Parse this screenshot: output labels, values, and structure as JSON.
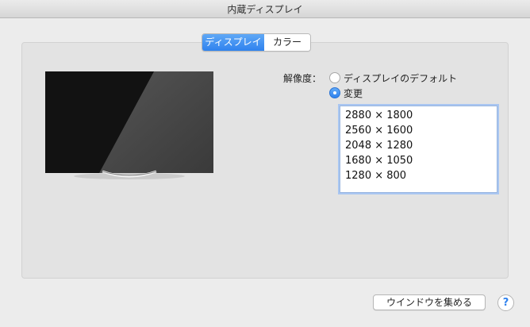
{
  "window": {
    "title": "内蔵ディスプレイ"
  },
  "tabs": [
    {
      "label": "ディスプレイ",
      "selected": true
    },
    {
      "label": "カラー",
      "selected": false
    }
  ],
  "resolution": {
    "label": "解像度：",
    "options": [
      {
        "label": "ディスプレイのデフォルト",
        "selected": false
      },
      {
        "label": "変更",
        "selected": true
      }
    ],
    "list": [
      "2880 × 1800",
      "2560 × 1600",
      "2048 × 1280",
      "1680 × 1050",
      "1280 × 800"
    ]
  },
  "footer": {
    "gather_windows_label": "ウインドウを集める",
    "help_label": "?"
  },
  "colors": {
    "accent": "#2f82ee",
    "panel": "#e3e3e3",
    "window": "#ececec"
  },
  "icons": {
    "monitor": "monitor-icon",
    "help": "help-icon"
  }
}
